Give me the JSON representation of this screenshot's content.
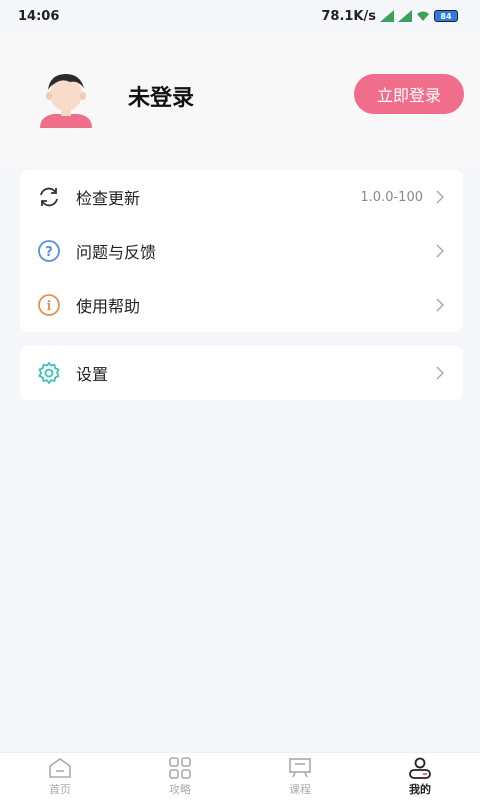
{
  "status_bar": {
    "time": "14:06",
    "network_speed": "78.1K/s",
    "battery": "84"
  },
  "profile": {
    "user_name": "未登录",
    "login_label": "立即登录"
  },
  "menu": {
    "check_update": {
      "label": "检查更新",
      "value": "1.0.0-100"
    },
    "feedback": {
      "label": "问题与反馈"
    },
    "help": {
      "label": "使用帮助"
    },
    "settings": {
      "label": "设置"
    }
  },
  "tabs": [
    {
      "label": "首页",
      "icon": "home-icon",
      "active": false
    },
    {
      "label": "攻略",
      "icon": "grid-icon",
      "active": false
    },
    {
      "label": "课程",
      "icon": "course-icon",
      "active": false
    },
    {
      "label": "我的",
      "icon": "user-icon",
      "active": true
    }
  ],
  "colors": {
    "accent": "#f06d8b",
    "background": "#f6f7fb"
  }
}
